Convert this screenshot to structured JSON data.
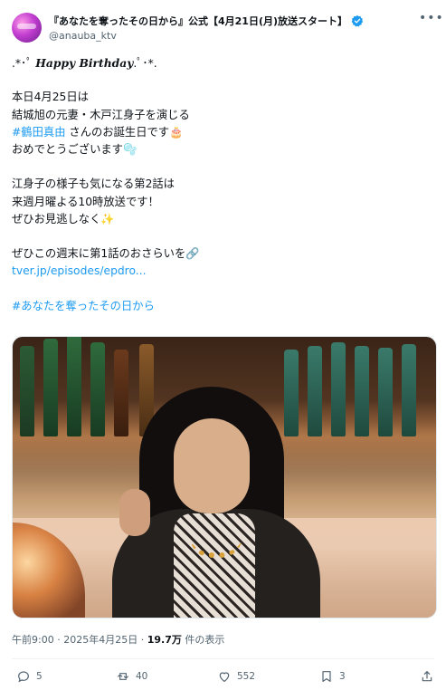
{
  "author": {
    "display_name": "『あなたを奪ったその日から』公式【4月21日(月)放送スタート】",
    "handle": "@anauba_ktv",
    "verified_color": "#1d9bf0"
  },
  "tweet": {
    "lines": [
      ".*･ﾟ Happy Birthday.ﾟ･*.",
      "",
      "本日4月25日は",
      "結城旭の元妻・木戸江身子を演じる",
      "#鶴田真由 さんのお誕生日です🎂",
      "おめでとうございます🫧",
      "",
      "江身子の様子も気になる第2話は",
      "来週月曜よる10時放送です！",
      "ぜひお見逃しなく✨",
      "",
      "ぜひこの週末に第1話のおさらいを🔗",
      "tver.jp/episodes/epdro...",
      "",
      "#あなたを奪ったその日から"
    ],
    "greeting_prefix": ".*･ﾟ ",
    "greeting": "Happy Birthday",
    "greeting_suffix": ".ﾟ･*.",
    "line_date": "本日4月25日は",
    "line_role": "結城旭の元妻・木戸江身子を演じる",
    "hashtag_actor": "#鶴田真由",
    "line_birthday": " さんのお誕生日です🎂",
    "line_congrats": "おめでとうございます🫧",
    "line_ep2": "江身子の様子も気になる第2話は",
    "line_air": "来週月曜よる10時放送です！",
    "line_dontmiss": "ぜひお見逃しなく✨",
    "line_recap": "ぜひこの週末に第1話のおさらいを🔗",
    "link_text": "tver.jp/episodes/epdro...",
    "hashtag_show": "#あなたを奪ったその日から"
  },
  "meta": {
    "time": "午前9:00",
    "date": "2025年4月25日",
    "views": "19.7万",
    "views_label": "件の表示"
  },
  "actions": {
    "replies": "5",
    "reposts": "40",
    "likes": "552",
    "bookmarks": "3"
  },
  "icons": [
    "verified-badge-icon",
    "more-icon",
    "reply-icon",
    "repost-icon",
    "like-icon",
    "bookmark-icon",
    "share-icon"
  ]
}
